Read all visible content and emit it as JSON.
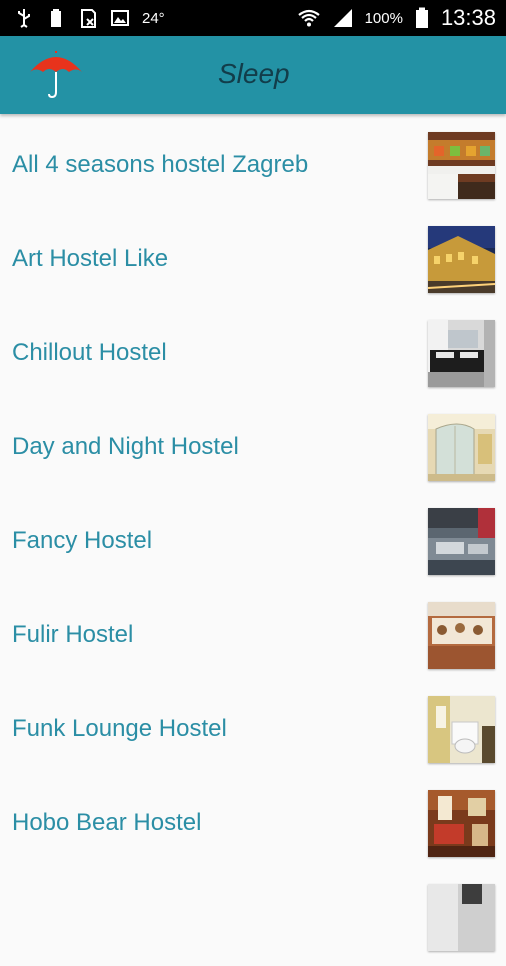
{
  "status_bar": {
    "temperature": "24°",
    "battery_percent": "100%",
    "clock": "13:38",
    "icons": [
      "usb-icon",
      "battery-full-icon",
      "sd-card-icon",
      "image-icon",
      "wifi-icon",
      "signal-icon",
      "battery-icon"
    ]
  },
  "app_bar": {
    "title": "Sleep",
    "logo_icon": "umbrella-icon",
    "accent_color": "#2392a5"
  },
  "hostels": [
    {
      "label": "All 4 seasons hostel Zagreb"
    },
    {
      "label": "Art Hostel Like"
    },
    {
      "label": "Chillout Hostel"
    },
    {
      "label": "Day and Night Hostel"
    },
    {
      "label": "Fancy Hostel"
    },
    {
      "label": "Fulir Hostel"
    },
    {
      "label": "Funk Lounge Hostel"
    },
    {
      "label": "Hobo Bear Hostel"
    }
  ]
}
